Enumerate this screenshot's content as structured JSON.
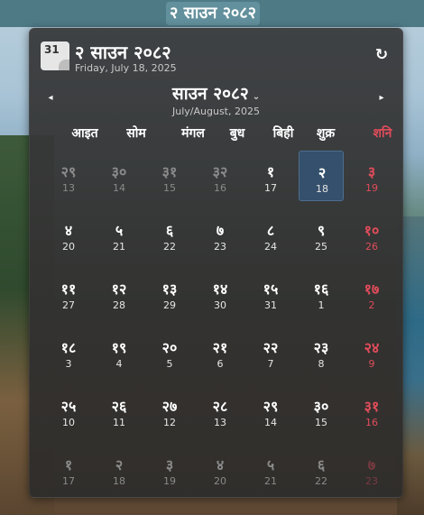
{
  "topbar": {
    "label": "२ साउन २०८२"
  },
  "header": {
    "icon_text": "31",
    "title": "२ साउन २०८२",
    "subtitle": "Friday, July 18, 2025"
  },
  "month": {
    "title": "साउन २०८२",
    "subtitle": "July/August, 2025",
    "prev_icon": "◂",
    "next_icon": "▸",
    "dropdown_icon": "⌄"
  },
  "refresh_icon": "↻",
  "weekdays": [
    "आइत",
    "सोम",
    "मंगल",
    "बुध",
    "बिही",
    "शुक्र",
    "शनि"
  ],
  "weeks": [
    [
      {
        "np": "२९",
        "en": "13",
        "muted": true
      },
      {
        "np": "३०",
        "en": "14",
        "muted": true
      },
      {
        "np": "३१",
        "en": "15",
        "muted": true
      },
      {
        "np": "३२",
        "en": "16",
        "muted": true
      },
      {
        "np": "१",
        "en": "17"
      },
      {
        "np": "२",
        "en": "18",
        "selected": true
      },
      {
        "np": "३",
        "en": "19"
      }
    ],
    [
      {
        "np": "४",
        "en": "20"
      },
      {
        "np": "५",
        "en": "21"
      },
      {
        "np": "६",
        "en": "22"
      },
      {
        "np": "७",
        "en": "23"
      },
      {
        "np": "८",
        "en": "24"
      },
      {
        "np": "९",
        "en": "25"
      },
      {
        "np": "१०",
        "en": "26"
      }
    ],
    [
      {
        "np": "११",
        "en": "27"
      },
      {
        "np": "१२",
        "en": "28"
      },
      {
        "np": "१३",
        "en": "29"
      },
      {
        "np": "१४",
        "en": "30"
      },
      {
        "np": "१५",
        "en": "31"
      },
      {
        "np": "१६",
        "en": "1"
      },
      {
        "np": "१७",
        "en": "2"
      }
    ],
    [
      {
        "np": "१८",
        "en": "3"
      },
      {
        "np": "१९",
        "en": "4"
      },
      {
        "np": "२०",
        "en": "5"
      },
      {
        "np": "२१",
        "en": "6"
      },
      {
        "np": "२२",
        "en": "7"
      },
      {
        "np": "२३",
        "en": "8"
      },
      {
        "np": "२४",
        "en": "9"
      }
    ],
    [
      {
        "np": "२५",
        "en": "10"
      },
      {
        "np": "२६",
        "en": "11"
      },
      {
        "np": "२७",
        "en": "12"
      },
      {
        "np": "२८",
        "en": "13"
      },
      {
        "np": "२९",
        "en": "14"
      },
      {
        "np": "३०",
        "en": "15"
      },
      {
        "np": "३१",
        "en": "16"
      }
    ],
    [
      {
        "np": "१",
        "en": "17",
        "muted": true
      },
      {
        "np": "२",
        "en": "18",
        "muted": true
      },
      {
        "np": "३",
        "en": "19",
        "muted": true
      },
      {
        "np": "४",
        "en": "20",
        "muted": true
      },
      {
        "np": "५",
        "en": "21",
        "muted": true
      },
      {
        "np": "६",
        "en": "22",
        "muted": true
      },
      {
        "np": "७",
        "en": "23",
        "muted": true
      }
    ]
  ],
  "colors": {
    "saturday": "#e04c5a",
    "selected_bg": "#35506c",
    "muted": "#8a8a8a"
  }
}
